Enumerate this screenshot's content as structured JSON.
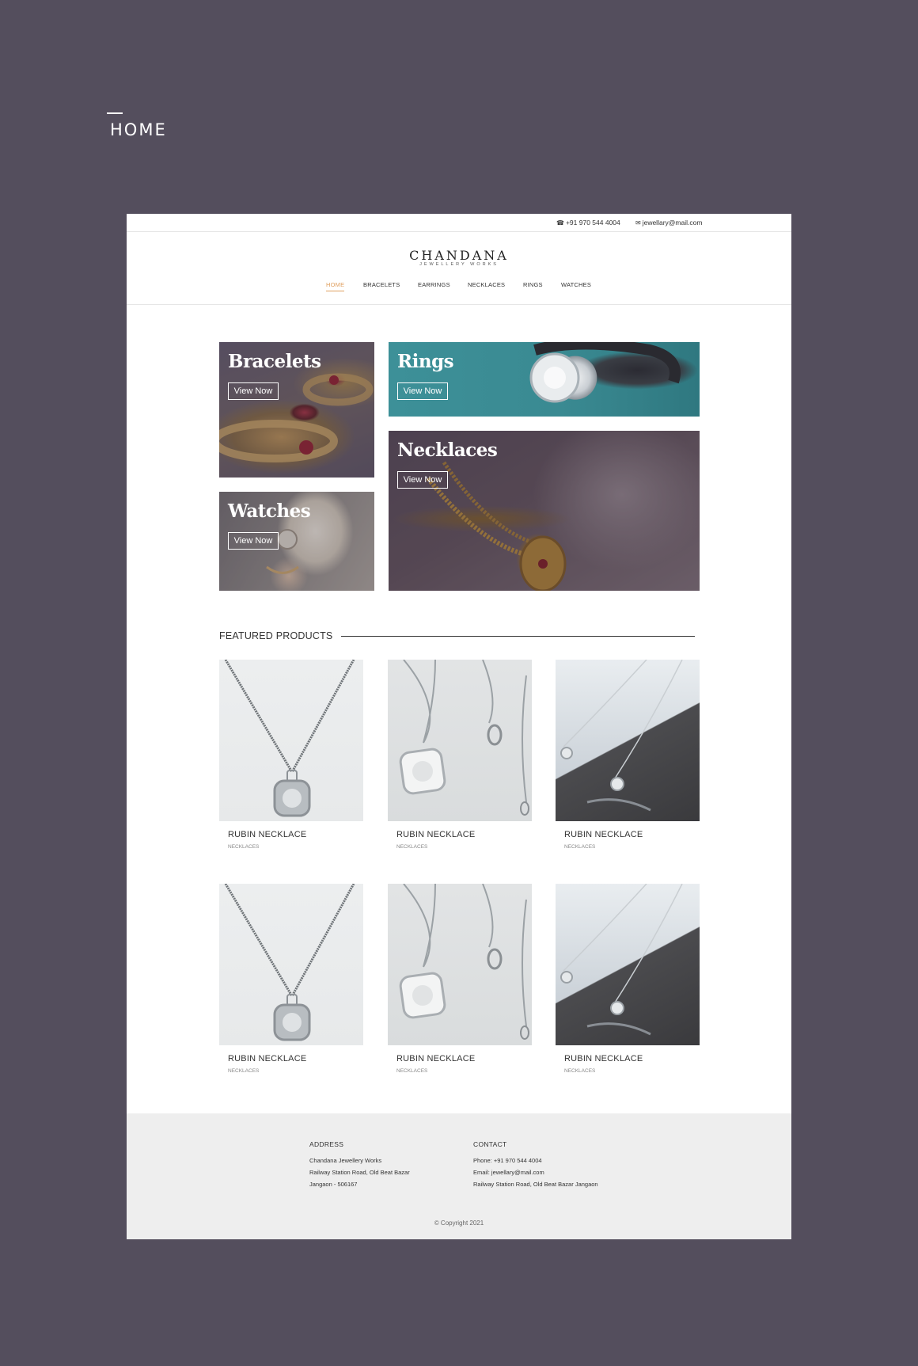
{
  "page_label": "HOME",
  "topbar": {
    "phone": "+91 970 544 4004",
    "email": "jewellary@mail.com"
  },
  "brand": {
    "name": "CHANDANA",
    "tagline": "JEWELLERY WORKS"
  },
  "nav": [
    "HOME",
    "BRACELETS",
    "EARRINGS",
    "NECKLACES",
    "RINGS",
    "WATCHES"
  ],
  "categories": {
    "bracelets": {
      "title": "Bracelets",
      "button": "View Now"
    },
    "rings": {
      "title": "Rings",
      "button": "View Now"
    },
    "watches": {
      "title": "Watches",
      "button": "View Now"
    },
    "necklaces": {
      "title": "Necklaces",
      "button": "View Now"
    }
  },
  "featured": {
    "title": "FEATURED PRODUCTS",
    "products": [
      {
        "name": "RUBIN NECKLACE",
        "category": "NECKLACES"
      },
      {
        "name": "RUBIN NECKLACE",
        "category": "NECKLACES"
      },
      {
        "name": "RUBIN NECKLACE",
        "category": "NECKLACES"
      },
      {
        "name": "RUBIN NECKLACE",
        "category": "NECKLACES"
      },
      {
        "name": "RUBIN NECKLACE",
        "category": "NECKLACES"
      },
      {
        "name": "RUBIN NECKLACE",
        "category": "NECKLACES"
      }
    ]
  },
  "footer": {
    "address": {
      "heading": "ADDRESS",
      "lines": [
        "Chandana Jewellery Works",
        "Railway Station Road, Old Beat Bazar",
        "Jangaon - 506167"
      ]
    },
    "contact": {
      "heading": "CONTACT",
      "lines": [
        "Phone: +91 970 544 4004",
        "Email: jewellary@mail.com",
        "Railway Station Road, Old Beat Bazar Jangaon"
      ]
    },
    "copyright": "© Copyright 2021"
  },
  "colors": {
    "background": "#544e5d",
    "accent": "#e0a060",
    "footer_bg": "#eeeeee"
  },
  "icons": {
    "phone": "phone-icon",
    "email": "mail-icon"
  }
}
